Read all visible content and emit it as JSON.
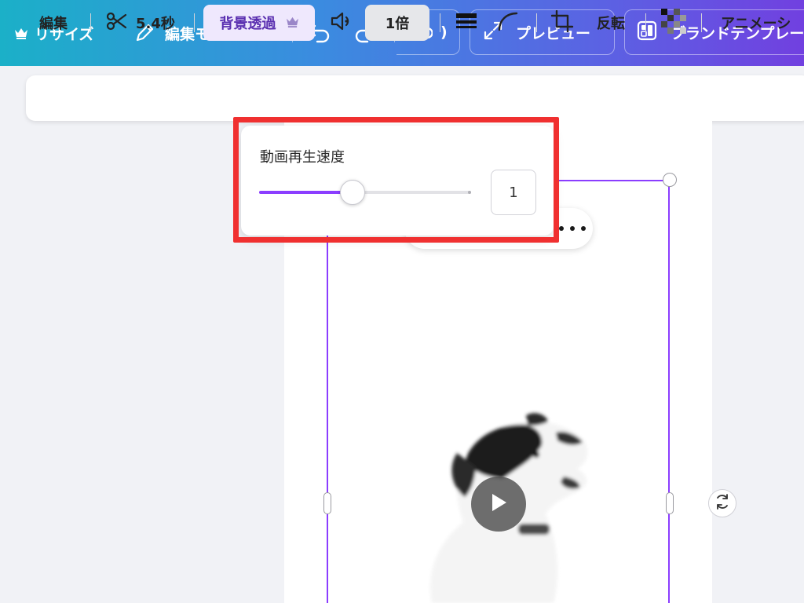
{
  "topbar": {
    "resize_label": "リサイズ",
    "edit_mode_label": "編集モード",
    "preview_label": "プレビュー",
    "brand_template_label": "ブランドテンプレー",
    "partial_label": ")"
  },
  "toolbar": {
    "edit_label": "編集",
    "duration_label": "5.4秒",
    "bg_remove_label": "背景透過",
    "speed_label": "1倍",
    "flip_label": "反転",
    "animation_label": "アニメーシ"
  },
  "speed_popup": {
    "title": "動画再生速度",
    "value": "1",
    "slider_fraction": 0.44
  },
  "colors": {
    "accent": "#8b3dff",
    "highlight_outline": "#f03030",
    "bg_remove_pill": "#efe8fd",
    "speed_pill": "#e6e7ea"
  },
  "icons": {
    "crown": "crown-icon",
    "pencil": "pencil-icon",
    "chevron": "chevron-down-icon",
    "undo": "undo-icon",
    "redo": "redo-icon",
    "cloud": "cloud-check-icon",
    "expand": "expand-icon",
    "template": "template-icon",
    "scissors": "scissors-icon",
    "volume": "volume-icon",
    "line_weight": "line-weight-icon",
    "corner": "corner-rounding-icon",
    "crop": "crop-icon",
    "transparency": "transparency-icon",
    "rotate": "rotate-icon",
    "play": "play-icon",
    "more": "more-dots-icon"
  }
}
